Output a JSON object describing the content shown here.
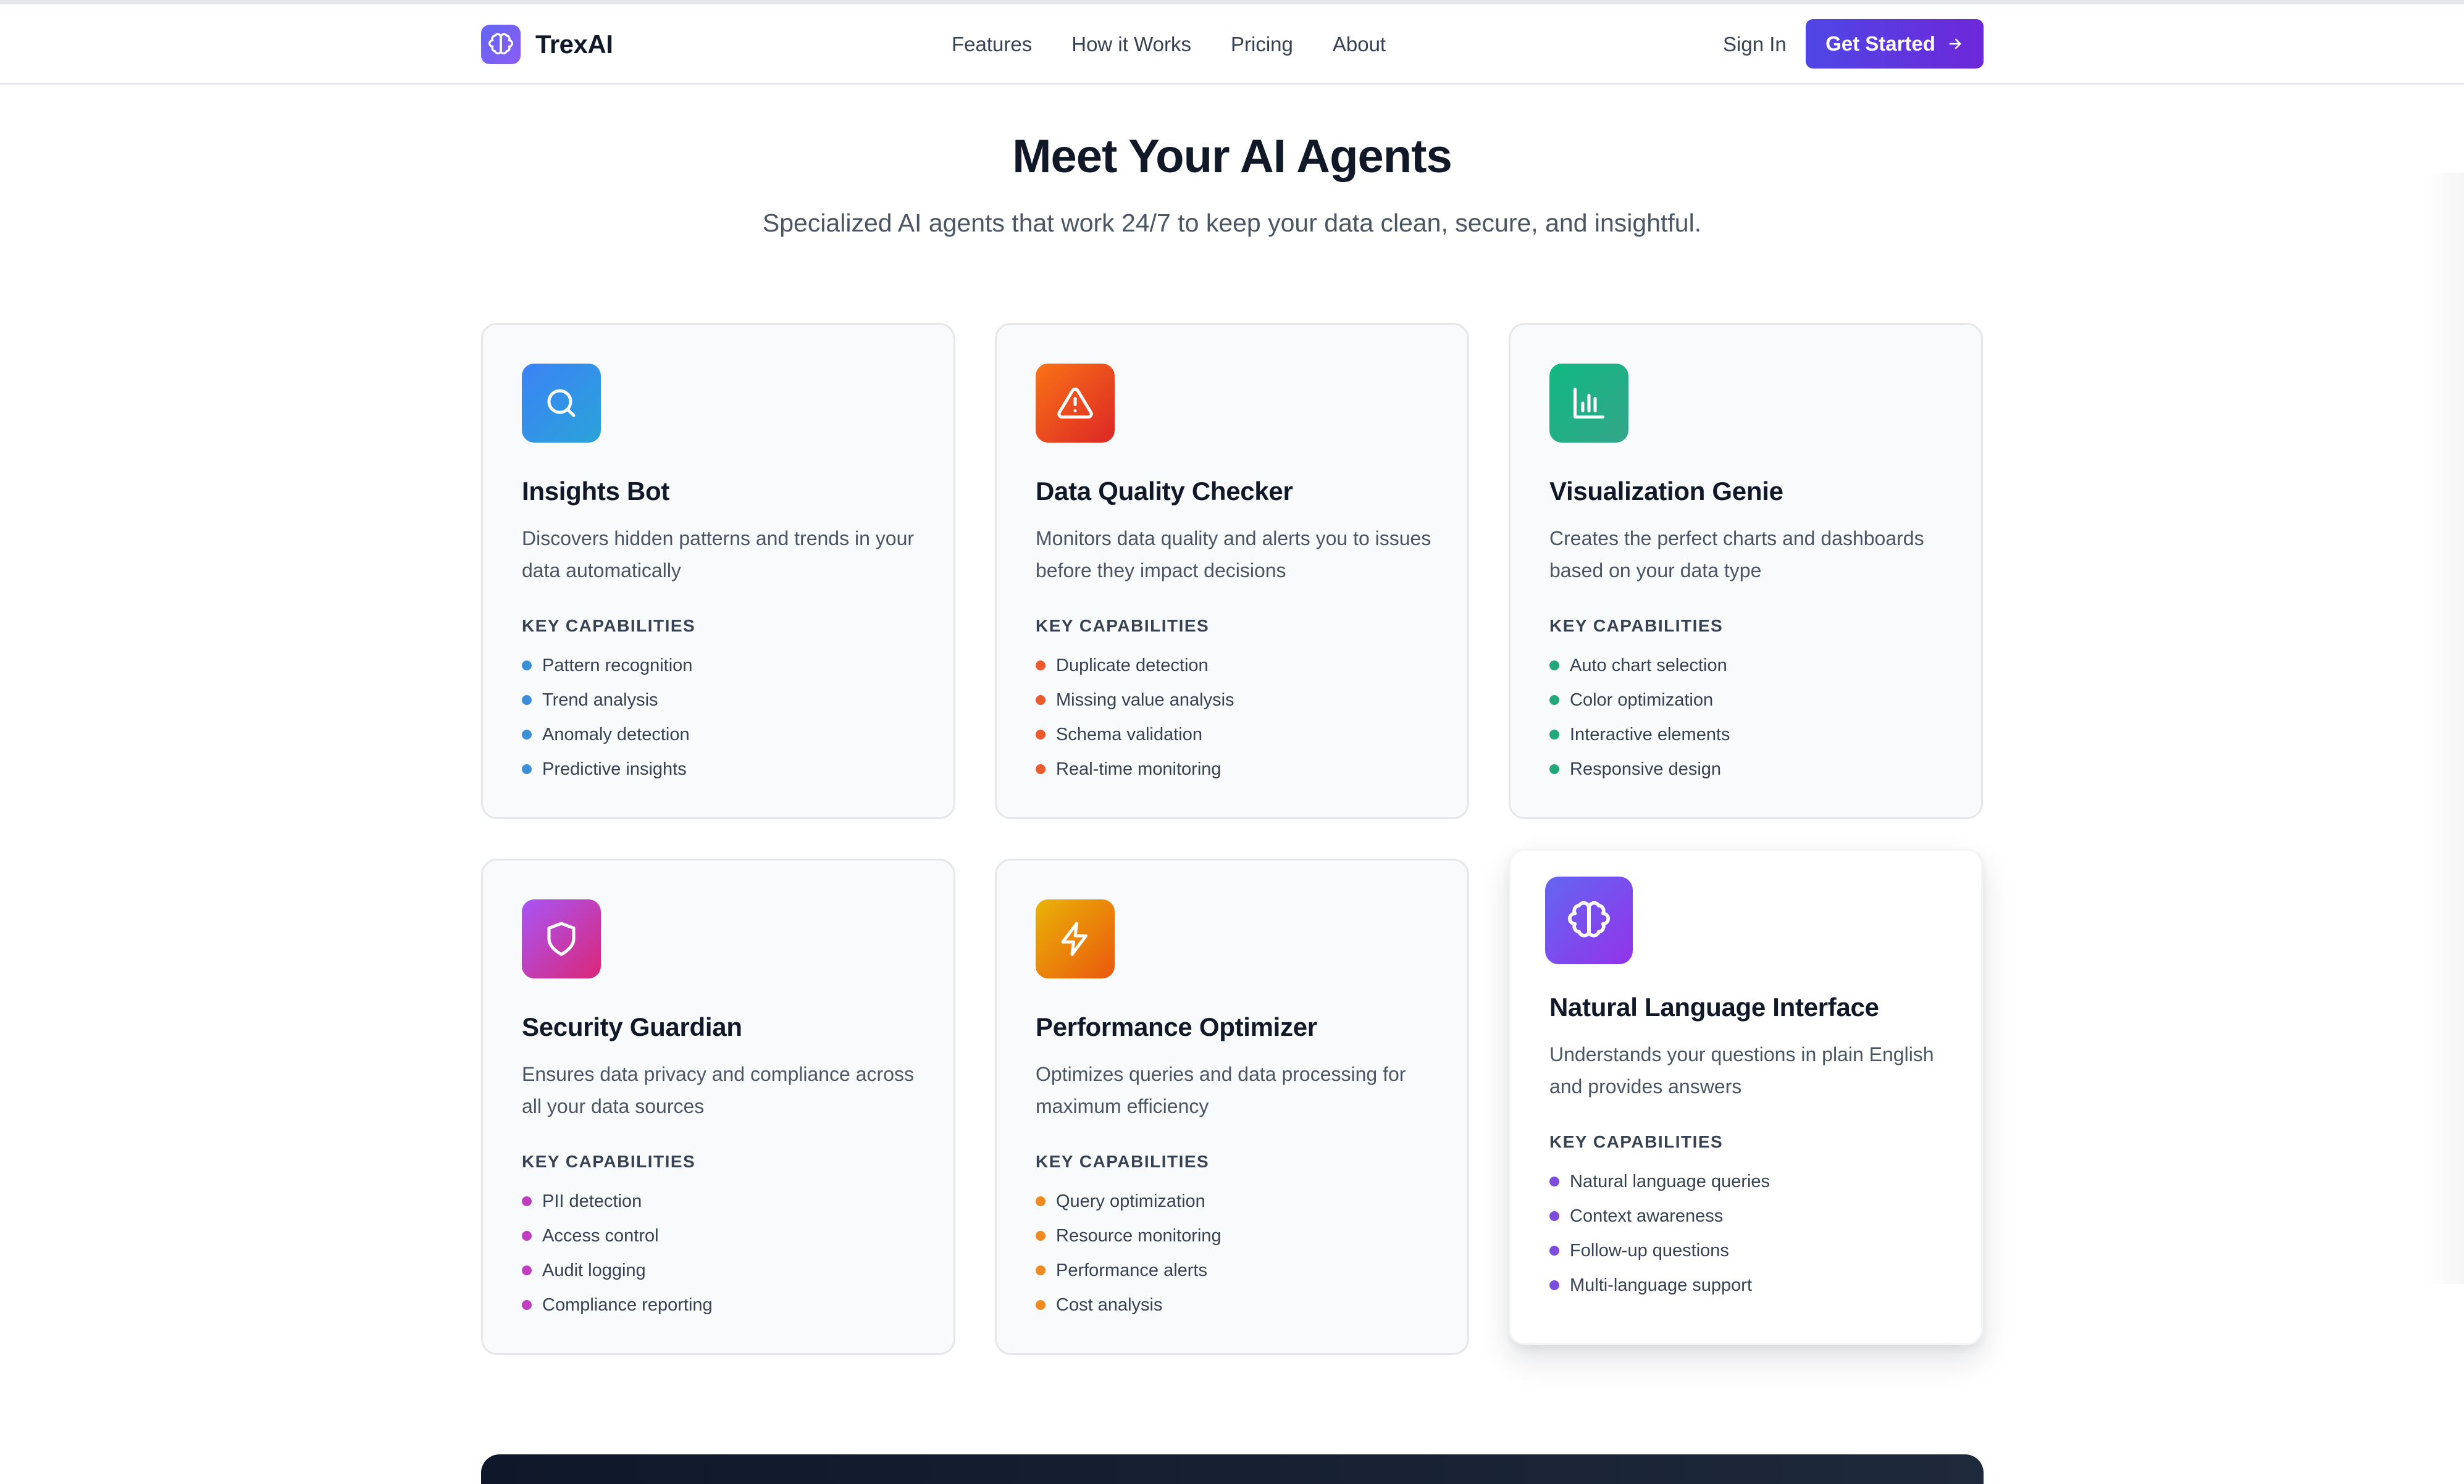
{
  "brand": {
    "name": "TrexAI",
    "logo_icon": "brain-icon"
  },
  "nav": {
    "links": [
      "Features",
      "How it Works",
      "Pricing",
      "About"
    ],
    "sign_in": "Sign In",
    "cta_label": "Get Started",
    "cta_icon": "arrow-right-icon"
  },
  "hero": {
    "title": "Meet Your AI Agents",
    "subtitle": "Specialized AI agents that work 24/7 to keep your data clean, secure, and insightful."
  },
  "agents": [
    {
      "title": "Insights Bot",
      "description": "Discovers hidden patterns and trends in your data automatically",
      "capabilities_heading": "KEY CAPABILITIES",
      "capabilities": [
        "Pattern recognition",
        "Trend analysis",
        "Anomaly detection",
        "Predictive insights"
      ],
      "icon": "search-icon",
      "gradient": [
        "#3b82f6",
        "#2aa3d8"
      ],
      "dot_color": "#3b8fd9"
    },
    {
      "title": "Data Quality Checker",
      "description": "Monitors data quality and alerts you to issues before they impact decisions",
      "capabilities_heading": "KEY CAPABILITIES",
      "capabilities": [
        "Duplicate detection",
        "Missing value analysis",
        "Schema validation",
        "Real-time monitoring"
      ],
      "icon": "alert-triangle-icon",
      "gradient": [
        "#f97316",
        "#dc2626"
      ],
      "dot_color": "#ea5a2c"
    },
    {
      "title": "Visualization Genie",
      "description": "Creates the perfect charts and dashboards based on your data type",
      "capabilities_heading": "KEY CAPABILITIES",
      "capabilities": [
        "Auto chart selection",
        "Color optimization",
        "Interactive elements",
        "Responsive design"
      ],
      "icon": "bar-chart-icon",
      "gradient": [
        "#10b981",
        "#34a58a"
      ],
      "dot_color": "#22a878"
    },
    {
      "title": "Security Guardian",
      "description": "Ensures data privacy and compliance across all your data sources",
      "capabilities_heading": "KEY CAPABILITIES",
      "capabilities": [
        "PII detection",
        "Access control",
        "Audit logging",
        "Compliance reporting"
      ],
      "icon": "shield-icon",
      "gradient": [
        "#a855f7",
        "#db2777"
      ],
      "dot_color": "#c03fc0"
    },
    {
      "title": "Performance Optimizer",
      "description": "Optimizes queries and data processing for maximum efficiency",
      "capabilities_heading": "KEY CAPABILITIES",
      "capabilities": [
        "Query optimization",
        "Resource monitoring",
        "Performance alerts",
        "Cost analysis"
      ],
      "icon": "lightning-icon",
      "gradient": [
        "#eab308",
        "#ea580c"
      ],
      "dot_color": "#ef8a1f"
    },
    {
      "title": "Natural Language Interface",
      "description": "Understands your questions in plain English and provides answers",
      "capabilities_heading": "KEY CAPABILITIES",
      "capabilities": [
        "Natural language queries",
        "Context awareness",
        "Follow-up questions",
        "Multi-language support"
      ],
      "icon": "brain-icon",
      "gradient": [
        "#6366f1",
        "#9333ea"
      ],
      "dot_color": "#7c4ddb"
    }
  ]
}
